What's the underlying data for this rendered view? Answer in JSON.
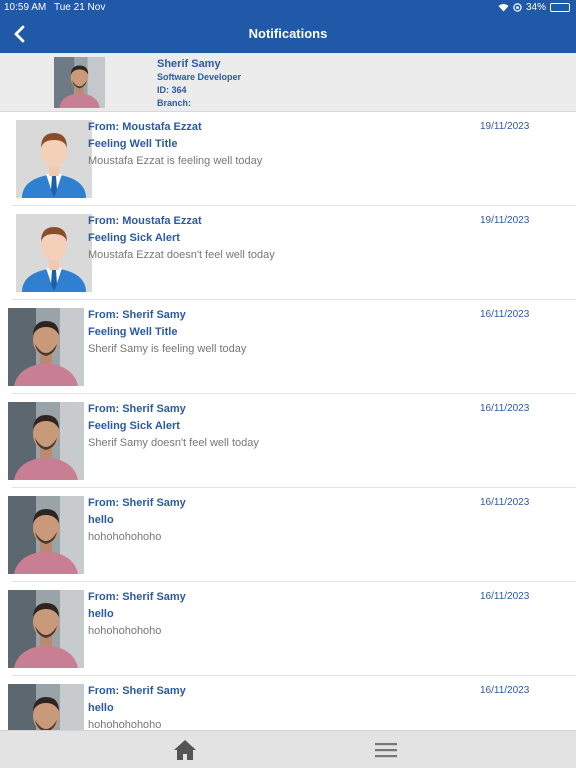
{
  "status_bar": {
    "time": "10:59 AM",
    "date": "Tue 21 Nov",
    "battery": "34%",
    "battery_level": 0.34
  },
  "header": {
    "title": "Notifications",
    "back_icon": "chevron-left-icon"
  },
  "profile": {
    "name": "Sherif Samy",
    "role": "Software Developer",
    "id_label": "ID: 364",
    "branch_label": "Branch:"
  },
  "notifications": [
    {
      "from": "From: Moustafa Ezzat",
      "title": "Feeling Well Title",
      "body": "Moustafa Ezzat is feeling well today",
      "date": "19/11/2023",
      "avatar": "placeholder-person-icon"
    },
    {
      "from": "From: Moustafa Ezzat",
      "title": "Feeling Sick Alert",
      "body": "Moustafa Ezzat doesn't feel well today",
      "date": "19/11/2023",
      "avatar": "placeholder-person-icon"
    },
    {
      "from": "From: Sherif Samy",
      "title": "Feeling Well Title",
      "body": "Sherif Samy is feeling well today",
      "date": "16/11/2023",
      "avatar": "photo"
    },
    {
      "from": "From: Sherif Samy",
      "title": "Feeling Sick Alert",
      "body": "Sherif Samy doesn't feel well today",
      "date": "16/11/2023",
      "avatar": "photo"
    },
    {
      "from": "From: Sherif Samy",
      "title": "hello",
      "body": "hohohohohoho",
      "date": "16/11/2023",
      "avatar": "photo"
    },
    {
      "from": "From: Sherif Samy",
      "title": "hello",
      "body": "hohohohohoho",
      "date": "16/11/2023",
      "avatar": "photo"
    },
    {
      "from": "From: Sherif Samy",
      "title": "hello",
      "body": "hohohohohoho",
      "date": "16/11/2023",
      "avatar": "photo"
    }
  ],
  "bottom_bar": {
    "home_icon": "home-icon",
    "menu_icon": "hamburger-menu-icon"
  },
  "colors": {
    "header_bg": "#2059a8",
    "accent_text": "#2c5aa0",
    "body_text": "#777777"
  }
}
